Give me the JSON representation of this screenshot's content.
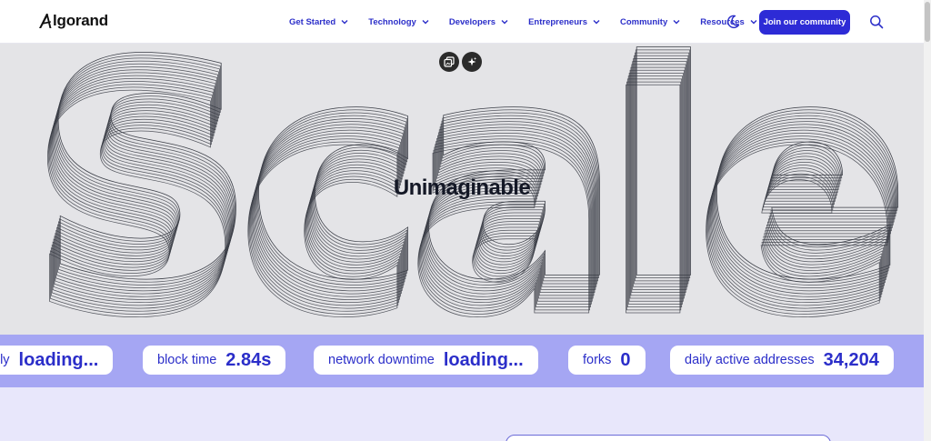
{
  "header": {
    "logo_text": "lgorand",
    "nav": [
      {
        "label": "Get Started"
      },
      {
        "label": "Technology"
      },
      {
        "label": "Developers"
      },
      {
        "label": "Entrepreneurs"
      },
      {
        "label": "Community"
      },
      {
        "label": "Resources"
      }
    ],
    "join_label": "Join our community"
  },
  "hero": {
    "big_word": "Scale",
    "subtitle": "Unimaginable"
  },
  "stats": [
    {
      "label": "ply",
      "value": "loading..."
    },
    {
      "label": "block time",
      "value": "2.84s"
    },
    {
      "label": "network downtime",
      "value": "loading..."
    },
    {
      "label": "forks",
      "value": "0"
    },
    {
      "label": "daily active addresses",
      "value": "34,204"
    }
  ],
  "icons": {
    "logo": "algorand-logo-icon",
    "nav_chevron": "chevron-down-icon",
    "theme": "moon-icon",
    "search": "search-icon",
    "tool_1": "copy-image-icon",
    "tool_2": "sparkle-icon"
  },
  "colors": {
    "brand": "#2d2bd6",
    "nav_text": "#2b2ec9",
    "hero_bg": "#e4e4e7",
    "stats_bg": "#a5a6f3",
    "lower_bg": "#e8e7fb"
  }
}
